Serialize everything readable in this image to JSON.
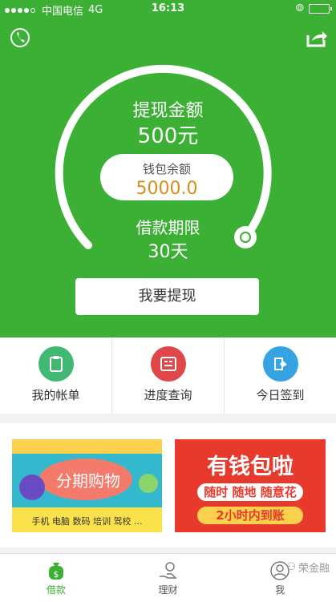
{
  "status": {
    "carrier": "中国电信",
    "network": "4G",
    "time": "16:13"
  },
  "header": {
    "title": ""
  },
  "main": {
    "withdraw_amount_label": "提现金额",
    "withdraw_amount": "500元",
    "wallet_label": "钱包余额",
    "wallet_value": "5000.0",
    "loan_term_label": "借款期限",
    "loan_term": "30天",
    "withdraw_button": "我要提现"
  },
  "features": [
    {
      "label": "我的帐单",
      "icon": "clipboard-icon",
      "color": "#42b875"
    },
    {
      "label": "进度查询",
      "icon": "progress-icon",
      "color": "#e0474b"
    },
    {
      "label": "今日签到",
      "icon": "checkin-icon",
      "color": "#36a3e3"
    }
  ],
  "banners": {
    "left": {
      "title": "分期购物",
      "subtitle": "手机 电脑 数码 培训 驾校 ..."
    },
    "right": {
      "title": "有钱包啦",
      "line1": "随时 随地 随意花",
      "line2": "2小时内到账"
    }
  },
  "tabs": [
    {
      "label": "借款",
      "icon": "money-bag-icon",
      "active": true
    },
    {
      "label": "理财",
      "icon": "finance-hand-icon",
      "active": false
    },
    {
      "label": "我",
      "icon": "user-icon",
      "active": false
    }
  ],
  "watermark": "荣金融",
  "colors": {
    "primary": "#3cb035",
    "accent": "#d4901a",
    "banner_right": "#e83a2c",
    "banner_left": "#34b8ce"
  }
}
